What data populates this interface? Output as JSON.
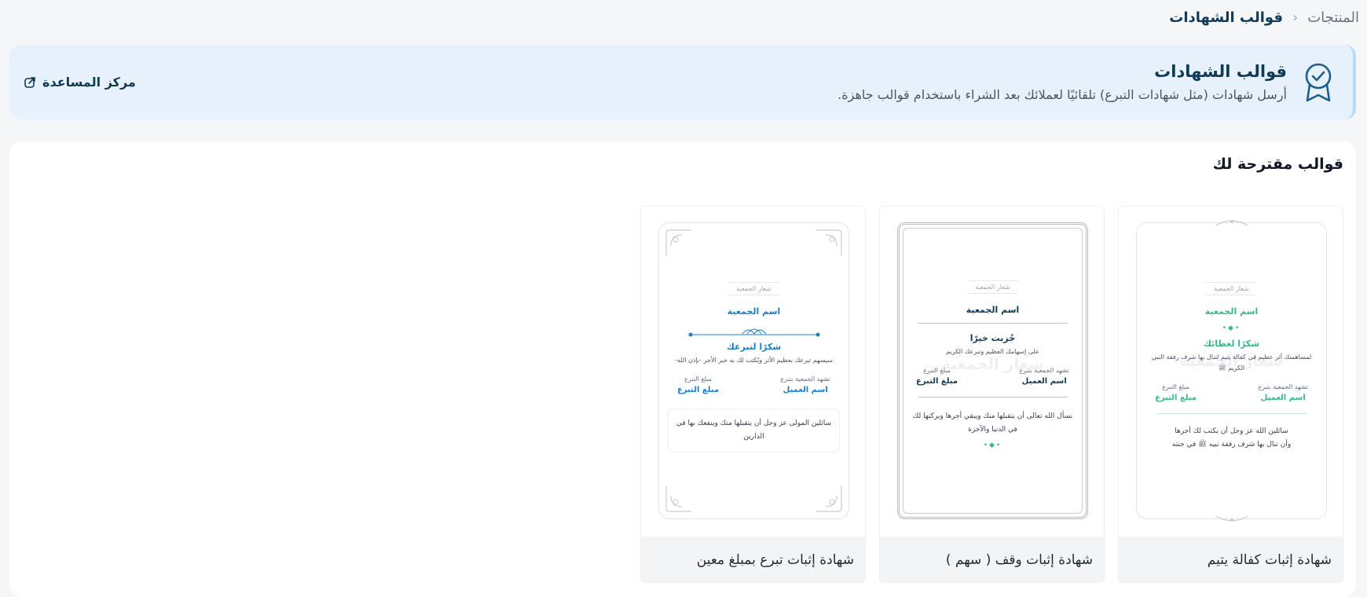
{
  "breadcrumb": {
    "parent": "المنتجات",
    "current": "قوالب الشهادات"
  },
  "banner": {
    "title": "قوالب الشهادات",
    "description": "أرسل شهادات (مثل شهادات التبرع) تلقائيًا لعملائك بعد الشراء باستخدام قوالب جاهزة.",
    "help_label": "مركز المساعدة"
  },
  "section": {
    "title": "قوالب مقترحة لك"
  },
  "colors": {
    "accent": "#0f3b57",
    "green": "#3bb88a",
    "blue": "#1d7fc4",
    "banner_bg": "#e6f1fc"
  },
  "cards": [
    {
      "title": "شهادة إثبات كفالة يتيم",
      "cert": {
        "logo": "شعار الجمعية",
        "org": "اسم الجمعية",
        "thanks": "شكرًا لعطائك",
        "body": "لمساهمتك أثر عظيم في كفالة يتيم لتنال بها شرف رفقة النبي الكريم ﷺ",
        "watermark": "شعار الجمعية",
        "label_right": "تشهد الجمعية بتبرع",
        "label_left": "مبلغ التبرع",
        "value_right": "اسم العميل",
        "value_left": "مبلغ التبرع",
        "prayer_1": "سائلين الله عز وجل أن يكتب لك أجرها",
        "prayer_2": "وأن تنال بها شرف رفقة نبيه ﷺ في جنته"
      }
    },
    {
      "title": "شهادة إثبات وقف ( سهم )",
      "cert": {
        "logo": "شعار الجمعية",
        "org": "اسم الجمعية",
        "thanks": "جُزيت خيرًا",
        "body": "على إسهامك العظيم وتبرعك الكريم",
        "watermark": "شعار الجمعية",
        "label_right": "تشهد الجمعية بتبرع",
        "label_left": "مبلغ التبرع",
        "value_right": "اسم العميل",
        "value_left": "مبلغ التبرع",
        "prayer": "نسأل الله تعالى أن يتقبلها منك ويبقي أجرها ويركتها لك في الدنيا والآخرة"
      }
    },
    {
      "title": "شهادة إثبات تبرع بمبلغ معين",
      "cert": {
        "logo": "شعار الجمعية",
        "org": "اسم الجمعية",
        "thanks": "شكرًا لتبرعك",
        "body": "سيسهم تبرعك بعظيم الأثر ويُكتب لك به خير الأجر -بإذن الله-",
        "label_right": "تشهد الجمعية بتبرع",
        "label_left": "مبلغ التبرع",
        "value_right": "اسم العميل",
        "value_left": "مبلغ التبرع",
        "prayer": "سائلين المولى عز وجل أن يتقبلها منك وينفعك بها في الدارين"
      }
    }
  ]
}
